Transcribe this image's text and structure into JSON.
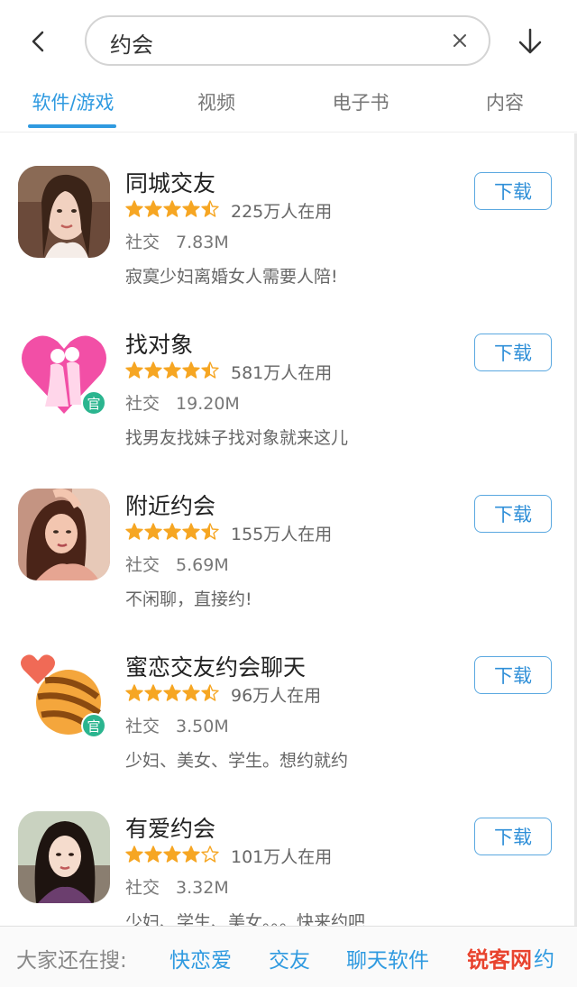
{
  "search": {
    "query": "约会"
  },
  "tabs": [
    {
      "label": "软件/游戏",
      "active": true
    },
    {
      "label": "视频",
      "active": false
    },
    {
      "label": "电子书",
      "active": false
    },
    {
      "label": "内容",
      "active": false
    }
  ],
  "apps": [
    {
      "name": "同城交友",
      "rating": 4.5,
      "users": "225万人在用",
      "category": "社交",
      "size": "7.83M",
      "description": "寂寞少妇离婚女人需要人陪!",
      "download_label": "下载",
      "official": false,
      "icon": "portrait-icon"
    },
    {
      "name": "找对象",
      "rating": 4.5,
      "users": "581万人在用",
      "category": "社交",
      "size": "19.20M",
      "description": "找男友找妹子找对象就来这儿",
      "download_label": "下载",
      "official": true,
      "official_label": "官",
      "icon": "pink-heart-couple-icon"
    },
    {
      "name": "附近约会",
      "rating": 4.5,
      "users": "155万人在用",
      "category": "社交",
      "size": "5.69M",
      "description": "不闲聊，直接约!",
      "download_label": "下载",
      "official": false,
      "icon": "portrait-icon"
    },
    {
      "name": "蜜恋交友约会聊天",
      "rating": 4.5,
      "users": "96万人在用",
      "category": "社交",
      "size": "3.50M",
      "description": "少妇、美女、学生。想约就约",
      "download_label": "下载",
      "official": true,
      "official_label": "官",
      "icon": "striped-ball-heart-icon"
    },
    {
      "name": "有爱约会",
      "rating": 4,
      "users": "101万人在用",
      "category": "社交",
      "size": "3.32M",
      "description": "少妇、学生、美女。。。快来约吧",
      "download_label": "下载",
      "official": false,
      "icon": "portrait-icon"
    }
  ],
  "bottom": {
    "label": "大家还在搜:",
    "links": [
      "快恋爱",
      "交友",
      "聊天软件"
    ],
    "watermark": "锐客网",
    "tail": "约"
  },
  "colors": {
    "accent": "#2f9ae0",
    "star": "#f6a623",
    "official": "#2bb58f"
  }
}
